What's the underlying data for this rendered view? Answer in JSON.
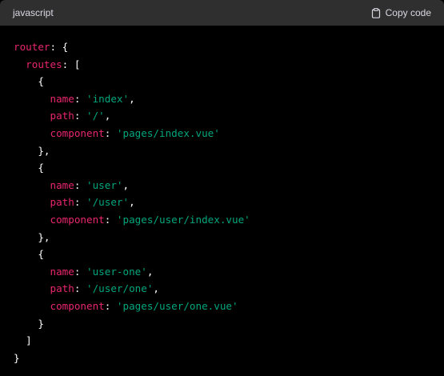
{
  "header": {
    "language": "javascript",
    "copy_label": "Copy code"
  },
  "code": {
    "lines": [
      [
        {
          "t": "router",
          "c": "key"
        },
        {
          "t": ": {",
          "c": "punc"
        }
      ],
      [
        {
          "t": "  ",
          "c": "punc"
        },
        {
          "t": "routes",
          "c": "key"
        },
        {
          "t": ": [",
          "c": "punc"
        }
      ],
      [
        {
          "t": "    {",
          "c": "punc"
        }
      ],
      [
        {
          "t": "      ",
          "c": "punc"
        },
        {
          "t": "name",
          "c": "key"
        },
        {
          "t": ": ",
          "c": "punc"
        },
        {
          "t": "'index'",
          "c": "str"
        },
        {
          "t": ",",
          "c": "punc"
        }
      ],
      [
        {
          "t": "      ",
          "c": "punc"
        },
        {
          "t": "path",
          "c": "key"
        },
        {
          "t": ": ",
          "c": "punc"
        },
        {
          "t": "'/'",
          "c": "str"
        },
        {
          "t": ",",
          "c": "punc"
        }
      ],
      [
        {
          "t": "      ",
          "c": "punc"
        },
        {
          "t": "component",
          "c": "key"
        },
        {
          "t": ": ",
          "c": "punc"
        },
        {
          "t": "'pages/index.vue'",
          "c": "str"
        }
      ],
      [
        {
          "t": "    },",
          "c": "punc"
        }
      ],
      [
        {
          "t": "    {",
          "c": "punc"
        }
      ],
      [
        {
          "t": "      ",
          "c": "punc"
        },
        {
          "t": "name",
          "c": "key"
        },
        {
          "t": ": ",
          "c": "punc"
        },
        {
          "t": "'user'",
          "c": "str"
        },
        {
          "t": ",",
          "c": "punc"
        }
      ],
      [
        {
          "t": "      ",
          "c": "punc"
        },
        {
          "t": "path",
          "c": "key"
        },
        {
          "t": ": ",
          "c": "punc"
        },
        {
          "t": "'/user'",
          "c": "str"
        },
        {
          "t": ",",
          "c": "punc"
        }
      ],
      [
        {
          "t": "      ",
          "c": "punc"
        },
        {
          "t": "component",
          "c": "key"
        },
        {
          "t": ": ",
          "c": "punc"
        },
        {
          "t": "'pages/user/index.vue'",
          "c": "str"
        }
      ],
      [
        {
          "t": "    },",
          "c": "punc"
        }
      ],
      [
        {
          "t": "    {",
          "c": "punc"
        }
      ],
      [
        {
          "t": "      ",
          "c": "punc"
        },
        {
          "t": "name",
          "c": "key"
        },
        {
          "t": ": ",
          "c": "punc"
        },
        {
          "t": "'user-one'",
          "c": "str"
        },
        {
          "t": ",",
          "c": "punc"
        }
      ],
      [
        {
          "t": "      ",
          "c": "punc"
        },
        {
          "t": "path",
          "c": "key"
        },
        {
          "t": ": ",
          "c": "punc"
        },
        {
          "t": "'/user/one'",
          "c": "str"
        },
        {
          "t": ",",
          "c": "punc"
        }
      ],
      [
        {
          "t": "      ",
          "c": "punc"
        },
        {
          "t": "component",
          "c": "key"
        },
        {
          "t": ": ",
          "c": "punc"
        },
        {
          "t": "'pages/user/one.vue'",
          "c": "str"
        }
      ],
      [
        {
          "t": "    }",
          "c": "punc"
        }
      ],
      [
        {
          "t": "  ]",
          "c": "punc"
        }
      ],
      [
        {
          "t": "}",
          "c": "punc"
        }
      ]
    ]
  },
  "colors": {
    "header_bg": "#2f2f2f",
    "code_bg": "#000000",
    "key": "#e9266e",
    "string": "#00a67d",
    "punctuation": "#ffffff"
  },
  "icons": {
    "copy": "clipboard-icon"
  }
}
